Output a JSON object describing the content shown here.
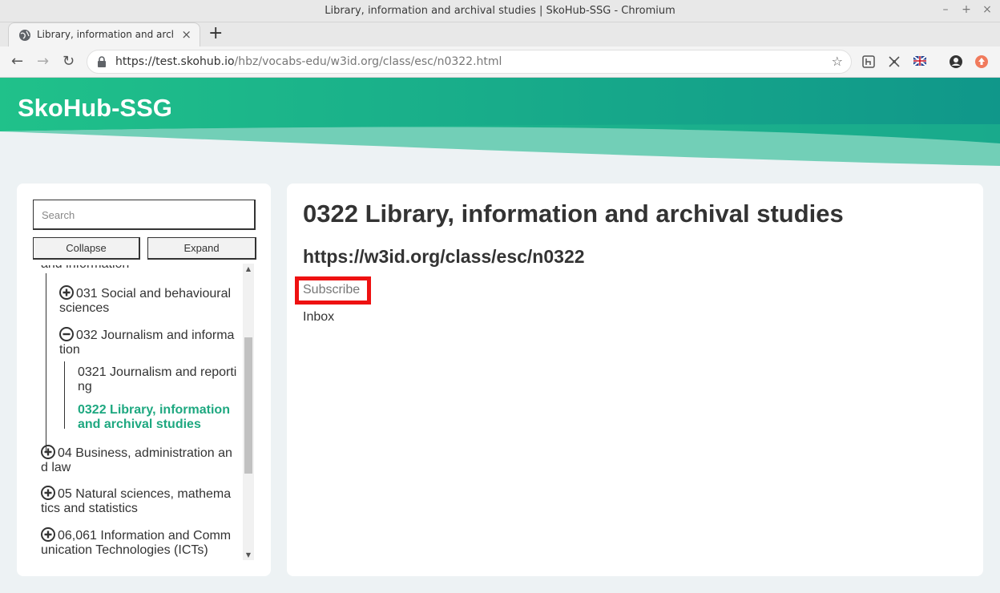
{
  "window": {
    "title": "Library, information and archival studies | SkoHub-SSG - Chromium",
    "controls": [
      "–",
      "+",
      "×"
    ]
  },
  "tab": {
    "title": "Library, information and archival studies",
    "close": "×",
    "new_tab": "+"
  },
  "toolbar": {
    "back": "←",
    "forward": "→",
    "reload": "↻",
    "url_host": "https://test.skohub.io",
    "url_path": "/hbz/vocabs-edu/w3id.org/class/esc/n0322.html",
    "bookmark": "☆"
  },
  "header": {
    "brand": "SkoHub-SSG",
    "gradient_start": "#20c18a",
    "gradient_end": "#10978a"
  },
  "sidebar": {
    "search_placeholder": "Search",
    "collapse_label": "Collapse",
    "expand_label": "Expand",
    "tree": {
      "clipped": "and information",
      "item_031": "031 Social and behavioural sciences",
      "item_032": "032 Journalism and information",
      "item_0321": "0321 Journalism and reporting",
      "item_0322": "0322 Library, information and archival studies",
      "item_04": "04 Business, administration and law",
      "item_05": "05 Natural sciences, mathematics and statistics",
      "item_06": "06,061 Information and Communication Technologies (ICTs)"
    }
  },
  "main": {
    "heading": "0322 Library, information and archival studies",
    "uri": "https://w3id.org/class/esc/n0322",
    "subscribe_label": "Subscribe",
    "inbox_label": "Inbox",
    "accent_color": "#1ea880",
    "highlight_color": "#ee1111"
  }
}
